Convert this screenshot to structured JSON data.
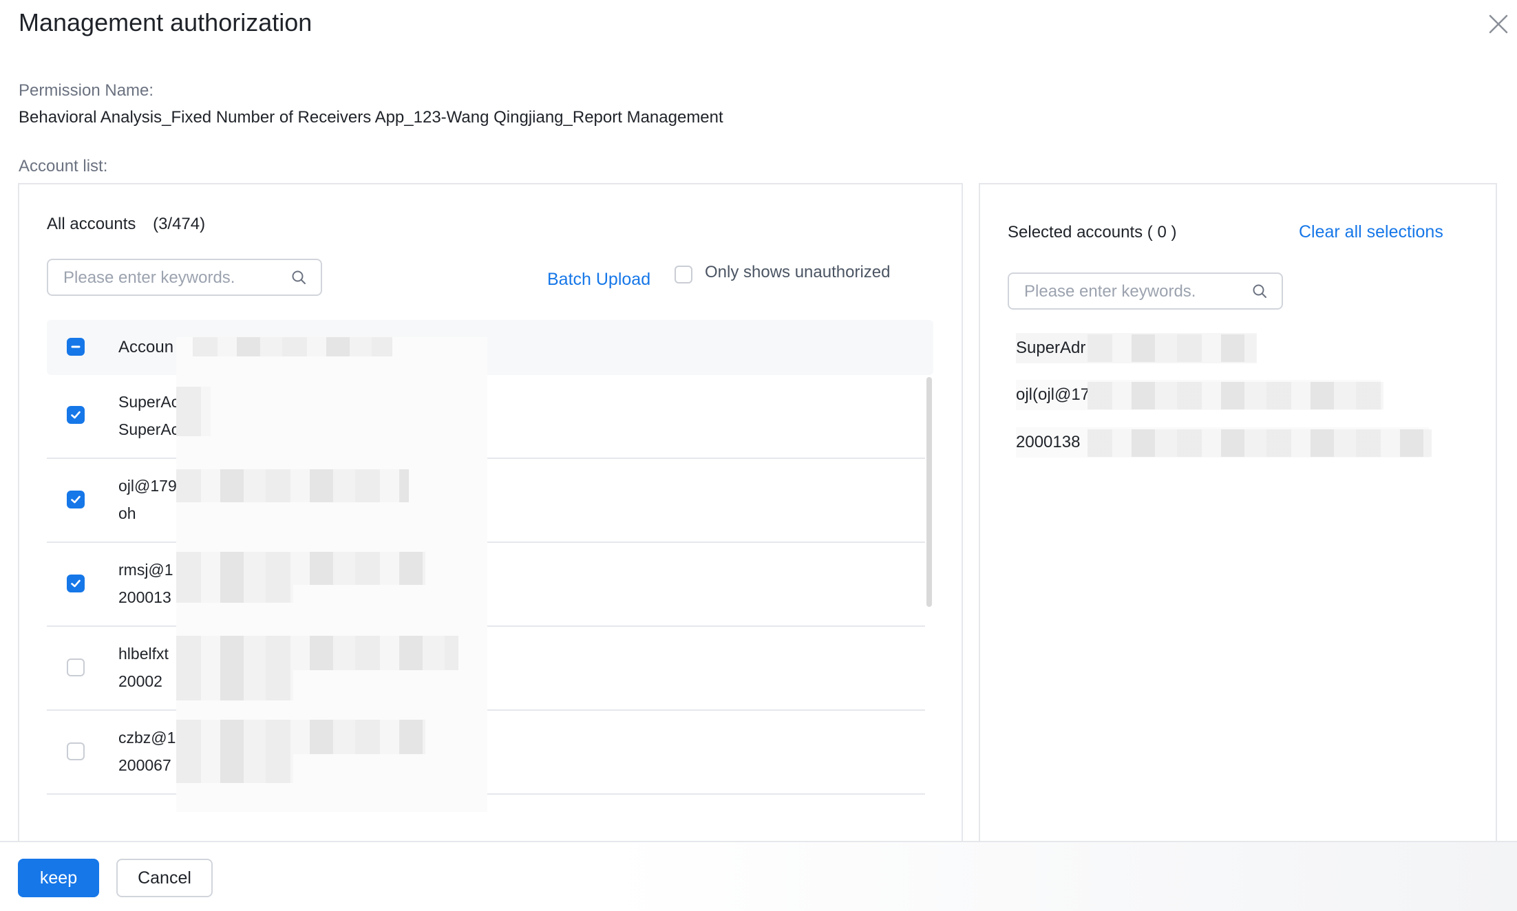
{
  "dialog": {
    "title": "Management authorization",
    "close_icon": "close-icon"
  },
  "permission": {
    "label": "Permission Name:",
    "value": "Behavioral Analysis_Fixed Number of Receivers App_123-Wang Qingjiang_Report Management"
  },
  "account_list_label": "Account list:",
  "all_accounts": {
    "heading": "All accounts",
    "count": "(3/474)",
    "search_placeholder": "Please enter keywords.",
    "batch_upload_label": "Batch Upload",
    "only_unauthorized_label": "Only shows unauthorized",
    "only_unauthorized_checked": false,
    "header_label": "Accoun",
    "header_checkbox_state": "partial",
    "rows": [
      {
        "line1": "SuperAc",
        "line2": "SuperAc",
        "checked": true
      },
      {
        "line1": "ojl@179",
        "line2": "oh",
        "checked": true
      },
      {
        "line1": "rmsj@1",
        "line2": "200013",
        "checked": true
      },
      {
        "line1": "hlbelfxt",
        "line2": "20002",
        "checked": false
      },
      {
        "line1": "czbz@1",
        "line2": "200067",
        "checked": false
      }
    ]
  },
  "selected_accounts": {
    "heading": "Selected accounts ( 0 )",
    "clear_label": "Clear all selections",
    "search_placeholder": "Please enter keywords.",
    "items": [
      "SuperAdr",
      "ojl(ojl@17",
      "2000138"
    ]
  },
  "footer": {
    "keep_label": "keep",
    "cancel_label": "Cancel"
  },
  "colors": {
    "accent": "#1677e8",
    "border": "#e5e7eb",
    "muted_text": "#6b7280"
  }
}
